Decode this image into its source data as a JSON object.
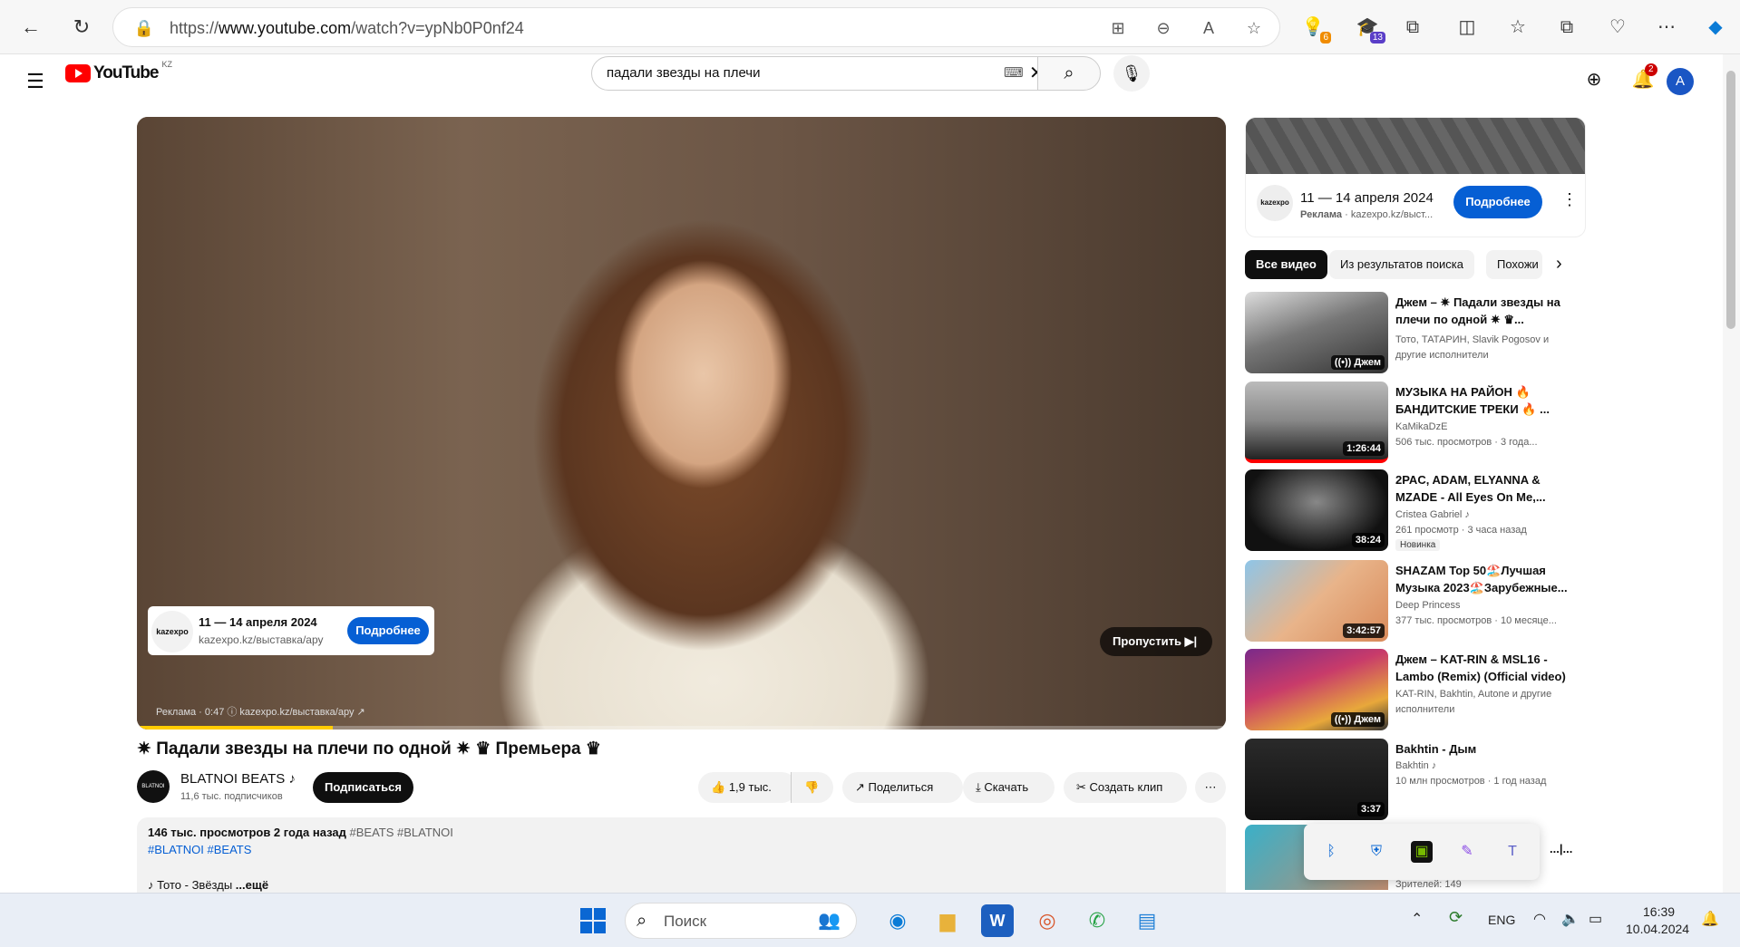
{
  "browser": {
    "url_prefix": "https://",
    "url_domain": "www.youtube.com",
    "url_path": "/watch?v=ypNb0P0nf24",
    "ext_badge_1": "6",
    "ext_badge_2": "13"
  },
  "header": {
    "logo_text": "YouTube",
    "country": "KZ",
    "search_value": "падали звезды на плечи",
    "notif_count": "2",
    "avatar_letter": "A"
  },
  "player": {
    "ad_card": {
      "logo": "kazexpo",
      "date": "11 — 14 апреля 2024",
      "url": "kazexpo.kz/выставка/ару",
      "button": "Подробнее"
    },
    "skip_label": "Пропустить",
    "ad_info": "Реклама · 0:47  ⓘ    kazexpo.kz/выставка/ару ↗",
    "ad_progress": 0.18
  },
  "video": {
    "title": "✷ Падали звезды на плечи по одной ✷ ♛ Премьера ♛",
    "channel": "BLATNOI BEATS ♪",
    "channel_avatar": "BLATNOI BEATS",
    "subscribers": "11,6 тыс. подписчиков",
    "subscribe": "Подписаться",
    "likes": "1,9 тыс.",
    "share": "Поделиться",
    "download": "Скачать",
    "clip": "Создать клип",
    "desc_stats": "146 тыс. просмотров  2 года назад",
    "desc_tags1": " #BEATS #BLATNOI",
    "desc_tags2": "#BLATNOI #BEATS",
    "desc_line3": "♪ Тото - Звёзды ",
    "desc_more": "...ещё"
  },
  "sidebar": {
    "ad": {
      "logo": "kazexpo",
      "date": "11 — 14 апреля 2024",
      "sponsor": "Реклама",
      "url": " · kazexpo.kz/выст...",
      "button": "Подробнее"
    },
    "chips": [
      "Все видео",
      "Из результатов поиска",
      "Похожи"
    ],
    "recs": [
      {
        "title": "Джем – ✷ Падали звезды на плечи по одной ✷ ♛...",
        "meta1": "Тото, ТАТАРИН, Slavik Pogosov и",
        "meta2": "другие исполнители",
        "overlay": "((•)) Джем"
      },
      {
        "title": "МУЗЫКА НА РАЙОН 🔥 БАНДИТСКИЕ ТРЕКИ 🔥 ...",
        "meta1": "KaMikaDzE",
        "meta2": "506 тыс. просмотров  · 3 года...",
        "duration": "1:26:44"
      },
      {
        "title": "2PAC, ADAM, ELYANNA & MZADE - All Eyes On Me,...",
        "meta1": "Cristea Gabriel ♪",
        "meta2": "261 просмотр  · 3 часа назад",
        "badge": "Новинка",
        "duration": "38:24"
      },
      {
        "title": "SHAZAM Top 50🏖️Лучшая Музыка 2023🏖️Зарубежные...",
        "meta1": "Deep Princess",
        "meta2": "377 тыс. просмотров  · 10 месяце...",
        "duration": "3:42:57"
      },
      {
        "title": "Джем – KAT-RIN & MSL16 - Lambo (Remix) (Official video)",
        "meta1": "KAT-RIN, Bakhtin, Autone и другие",
        "meta2": "исполнители",
        "overlay": "((•)) Джем"
      },
      {
        "title": "Bakhtin - Дым",
        "meta1": "Bakhtin ♪",
        "meta2": "10 млн просмотров  · 1 год назад",
        "duration": "3:37"
      },
      {
        "title": "...|...",
        "meta1": "Зрителей: 149"
      }
    ]
  },
  "taskbar": {
    "search_placeholder": "Поиск",
    "lang": "ENG",
    "time": "16:39",
    "date": "10.04.2024"
  },
  "colors": {
    "brand_red": "#ff0000",
    "accent_blue": "#065fd4"
  }
}
